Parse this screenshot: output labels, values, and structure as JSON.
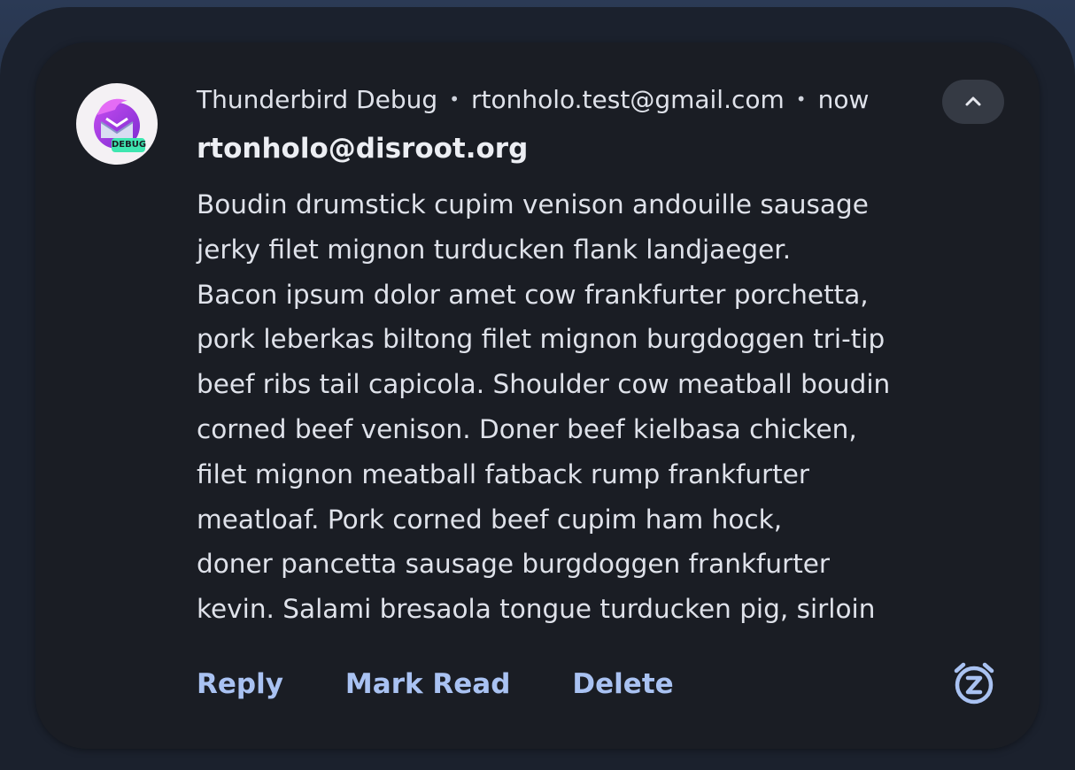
{
  "notification": {
    "app_name": "Thunderbird Debug",
    "separator": "•",
    "account": "rtonholo.test@gmail.com",
    "time": "now",
    "sender": "rtonholo@disroot.org",
    "avatar_badge": "DEBUG",
    "body_lines": [
      "Boudin drumstick cupim venison andouille sausage",
      "jerky filet mignon turducken flank landjaeger.",
      "Bacon ipsum dolor amet cow frankfurter porchetta,",
      "pork leberkas biltong filet mignon burgdoggen tri-tip",
      "beef ribs tail capicola. Shoulder cow meatball boudin",
      "corned beef venison. Doner beef kielbasa chicken,",
      "filet mignon meatball fatback rump frankfurter",
      "meatloaf. Pork corned beef cupim ham hock,",
      "doner pancetta sausage burgdoggen frankfurter",
      "kevin. Salami bresaola tongue turducken pig, sirloin"
    ],
    "actions": {
      "reply": "Reply",
      "mark_read": "Mark Read",
      "delete": "Delete"
    }
  },
  "icons": {
    "app": "thunderbird-logo",
    "collapse": "chevron-up-icon",
    "snooze": "snooze-alarm-icon"
  },
  "colors": {
    "card_background": "#1a1d24",
    "action_accent": "#a9c2f2",
    "badge": "#3ee6b0"
  }
}
